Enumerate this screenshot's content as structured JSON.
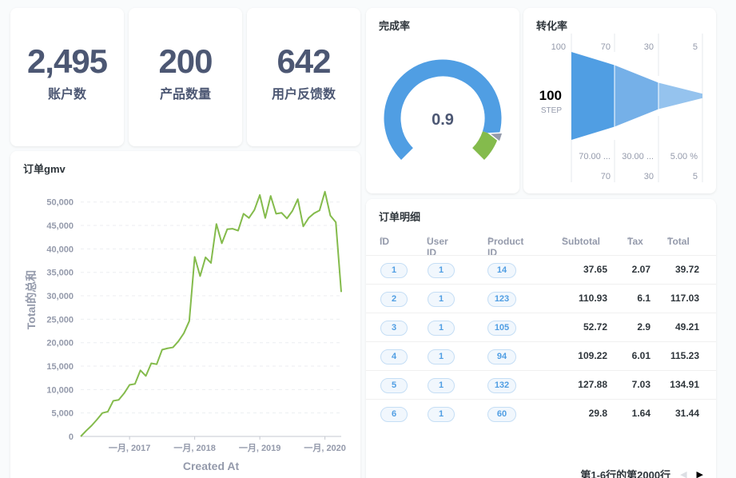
{
  "scalars": [
    {
      "value": "2,495",
      "label": "账户数"
    },
    {
      "value": "200",
      "label": "产品数量"
    },
    {
      "value": "642",
      "label": "用户反馈数"
    }
  ],
  "gauge": {
    "title": "完成率",
    "value": "0.9",
    "fraction": 0.9,
    "colors": {
      "main": "#509ee3",
      "end": "#84bb4c",
      "pointer": "#949aab"
    }
  },
  "funnel": {
    "title": "转化率",
    "first_label": "100",
    "head_value": "100",
    "head_unit": "STEP",
    "top_values": [
      "70",
      "30",
      "5"
    ],
    "percents": [
      "70.00 ...",
      "30.00 ...",
      "5.00 %"
    ],
    "bottom_values": [
      "70",
      "30",
      "5"
    ],
    "levels": [
      100,
      70,
      30,
      5
    ],
    "colors": [
      "#509ee3",
      "#75b0e8",
      "#95c3ee"
    ]
  },
  "line_chart": {
    "title": "订单gmv",
    "chart_data": {
      "type": "line",
      "xlabel": "Created At",
      "ylabel": "Total的总和",
      "ylim": [
        0,
        52000
      ],
      "yticks": [
        "0",
        "5,000",
        "10,000",
        "15,000",
        "20,000",
        "25,000",
        "30,000",
        "35,000",
        "40,000",
        "45,000",
        "50,000"
      ],
      "xticks": [
        "一月, 2017",
        "一月, 2018",
        "一月, 2019",
        "一月, 2020"
      ],
      "x_range": [
        "2016-04",
        "2020-04"
      ],
      "color": "#84bb4c",
      "series": [
        {
          "x": [
            "2016-04",
            "2016-05",
            "2016-06",
            "2016-07",
            "2016-08",
            "2016-09",
            "2016-10",
            "2016-11",
            "2016-12",
            "2017-01",
            "2017-02",
            "2017-03",
            "2017-04",
            "2017-05",
            "2017-06",
            "2017-07",
            "2017-08",
            "2017-09",
            "2017-10",
            "2017-11",
            "2017-12",
            "2018-01",
            "2018-02",
            "2018-03",
            "2018-04",
            "2018-05",
            "2018-06",
            "2018-07",
            "2018-08",
            "2018-09",
            "2018-10",
            "2018-11",
            "2018-12",
            "2019-01",
            "2019-02",
            "2019-03",
            "2019-04",
            "2019-05",
            "2019-06",
            "2019-07",
            "2019-08",
            "2019-09",
            "2019-10",
            "2019-11",
            "2019-12",
            "2020-01",
            "2020-02",
            "2020-03",
            "2020-04"
          ],
          "values": [
            0,
            1200,
            2300,
            3600,
            5000,
            5300,
            7600,
            7800,
            9200,
            11000,
            11200,
            14100,
            12900,
            15600,
            15400,
            18500,
            18800,
            19000,
            20300,
            22000,
            24600,
            38300,
            34200,
            38200,
            37000,
            45300,
            41200,
            44200,
            44300,
            43900,
            47500,
            46600,
            48300,
            51500,
            46600,
            51300,
            47500,
            47700,
            46500,
            48100,
            50600,
            44800,
            46600,
            47600,
            48200,
            52200,
            47100,
            45700,
            30800
          ]
        }
      ]
    }
  },
  "table": {
    "title": "订单明细",
    "columns": [
      "ID",
      "User ID",
      "Product ID",
      "Subtotal",
      "Tax",
      "Total"
    ],
    "rows": [
      [
        "1",
        "1",
        "14",
        "37.65",
        "2.07",
        "39.72"
      ],
      [
        "2",
        "1",
        "123",
        "110.93",
        "6.1",
        "117.03"
      ],
      [
        "3",
        "1",
        "105",
        "52.72",
        "2.9",
        "49.21"
      ],
      [
        "4",
        "1",
        "94",
        "109.22",
        "6.01",
        "115.23"
      ],
      [
        "5",
        "1",
        "132",
        "127.88",
        "7.03",
        "134.91"
      ],
      [
        "6",
        "1",
        "60",
        "29.8",
        "1.64",
        "31.44"
      ]
    ],
    "pagination": "第1-6行的第2000行",
    "prev_icon": "chevron-left-icon",
    "next_icon": "chevron-right-icon"
  }
}
